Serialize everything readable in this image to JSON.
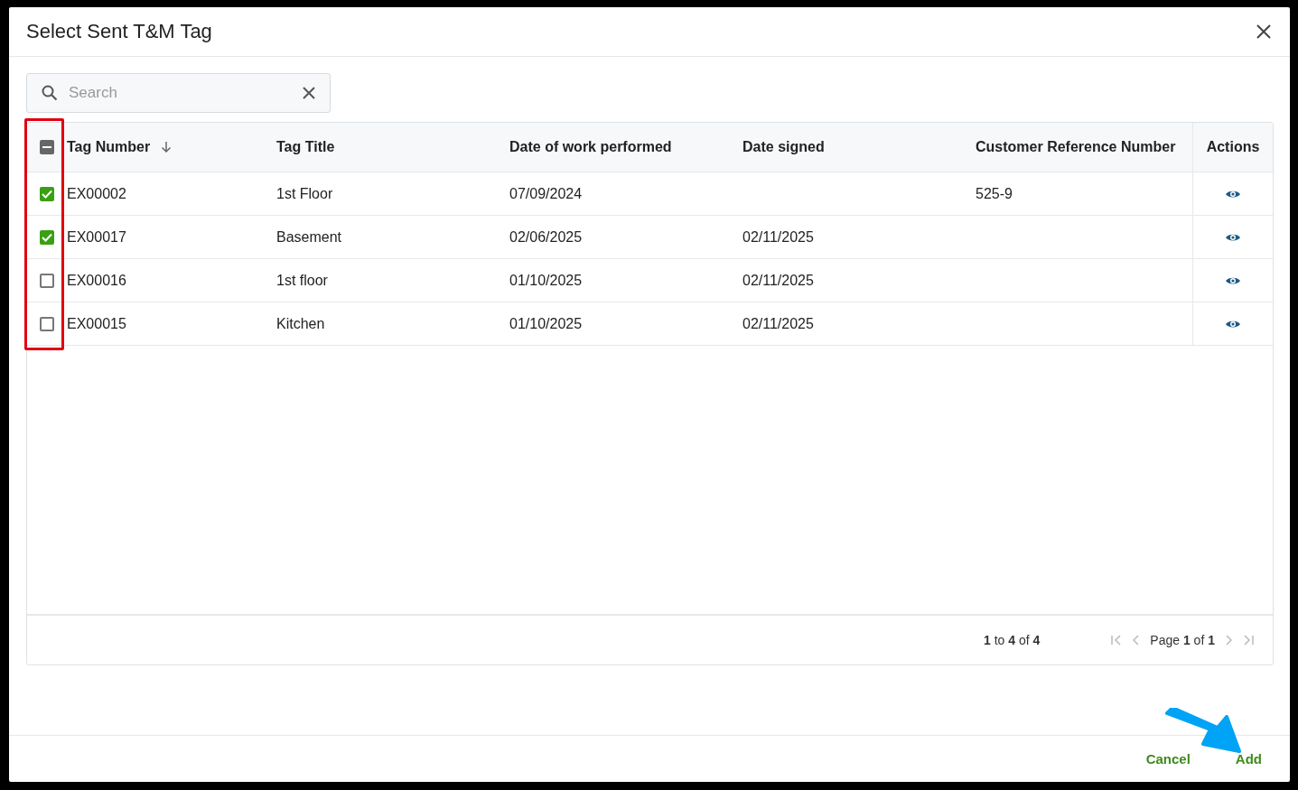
{
  "dialog": {
    "title": "Select Sent T&M Tag"
  },
  "search": {
    "placeholder": "Search"
  },
  "table": {
    "select_all": {
      "indeterminate": true
    },
    "columns": [
      {
        "label": "Tag Number",
        "sorted": true
      },
      {
        "label": "Tag Title",
        "sorted": false
      },
      {
        "label": "Date of work performed",
        "sorted": false
      },
      {
        "label": "Date signed",
        "sorted": false
      },
      {
        "label": "Customer Reference Number",
        "sorted": false
      },
      {
        "label": "Actions",
        "sorted": false
      }
    ],
    "rows": [
      {
        "checked": true,
        "cells": [
          "EX00002",
          "1st Floor",
          "07/09/2024",
          "",
          "525-9"
        ]
      },
      {
        "checked": true,
        "cells": [
          "EX00017",
          "Basement",
          "02/06/2025",
          "02/11/2025",
          ""
        ]
      },
      {
        "checked": false,
        "cells": [
          "EX00016",
          "1st floor",
          "01/10/2025",
          "02/11/2025",
          ""
        ]
      },
      {
        "checked": false,
        "cells": [
          "EX00015",
          "Kitchen",
          "01/10/2025",
          "02/11/2025",
          ""
        ]
      }
    ]
  },
  "pagination": {
    "summary": "**1** to **4** of **4**",
    "page": "Page **1** of **1**"
  },
  "buttons": [
    "Cancel",
    "Add"
  ]
}
